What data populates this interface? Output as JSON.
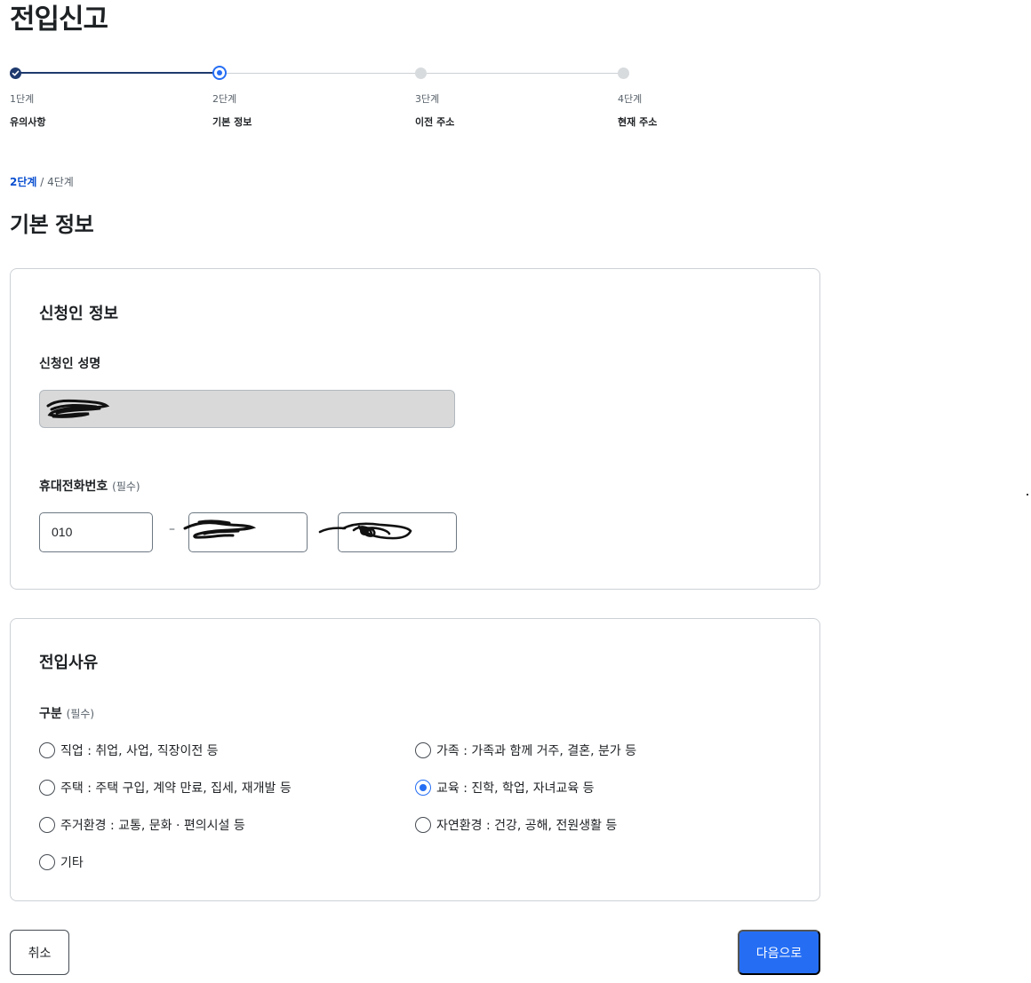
{
  "page": {
    "title": "전입신고"
  },
  "stepper": {
    "steps": [
      {
        "num": "1단계",
        "label": "유의사항",
        "state": "done"
      },
      {
        "num": "2단계",
        "label": "기본 정보",
        "state": "current"
      },
      {
        "num": "3단계",
        "label": "이전 주소",
        "state": "todo"
      },
      {
        "num": "4단계",
        "label": "현재 주소",
        "state": "todo"
      }
    ]
  },
  "progress": {
    "current": "2단계",
    "separator": " / ",
    "total": "4단계"
  },
  "section": {
    "title": "기본 정보"
  },
  "applicant": {
    "title": "신청인 정보",
    "name_label": "신청인 성명",
    "phone_label": "휴대전화번호",
    "required": "(필수)",
    "phone_prefix": "010",
    "phone_dash": "–"
  },
  "reason": {
    "title": "전입사유",
    "category_label": "구분",
    "required": "(필수)",
    "options": [
      {
        "label": "직업 : 취업, 사업, 직장이전 등",
        "selected": false
      },
      {
        "label": "가족 : 가족과 함께 거주, 결혼, 분가 등",
        "selected": false
      },
      {
        "label": "주택 : 주택 구입, 계약 만료, 집세, 재개발 등",
        "selected": false
      },
      {
        "label": "교육 : 진학, 학업, 자녀교육 등",
        "selected": true
      },
      {
        "label": "주거환경 : 교통, 문화 · 편의시설 등",
        "selected": false
      },
      {
        "label": "자연환경 : 건강, 공해, 전원생활 등",
        "selected": false
      },
      {
        "label": "기타",
        "selected": false
      }
    ]
  },
  "actions": {
    "cancel": "취소",
    "next": "다음으로"
  },
  "colors": {
    "primary": "#256ef4",
    "done": "#1f3a6e",
    "border": "#cdd1d5"
  },
  "icons": {
    "step_done": "check-icon"
  }
}
